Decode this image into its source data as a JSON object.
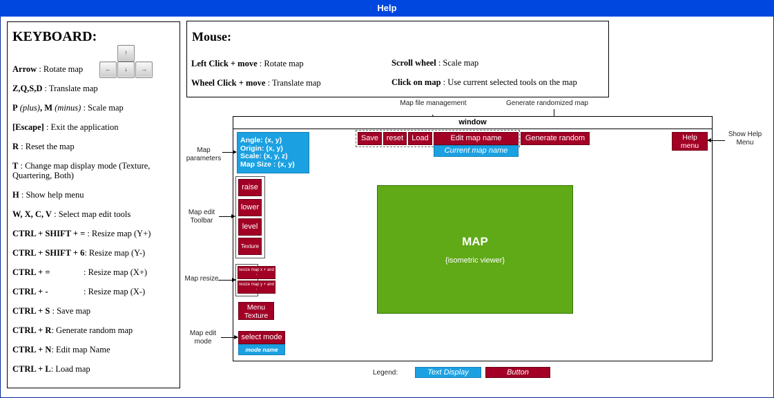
{
  "title": "Help",
  "keyboard": {
    "heading": "KEYBOARD:",
    "key_up": "↑",
    "key_left": "←",
    "key_down": "↓",
    "key_right": "→",
    "rows": [
      {
        "key": "Arrow",
        "desc": "   : Rotate map"
      },
      {
        "key": "Z,Q,S,D",
        "desc": " : Translate map"
      },
      {
        "key": "P",
        "mid1": " (plus)",
        "key2": ", M",
        "mid2": " (minus)",
        "desc": " : Scale map"
      },
      {
        "key": "[Escape]",
        "desc": " : Exit the application"
      },
      {
        "key": "R",
        "desc": " : Reset the map"
      },
      {
        "key": "T",
        "desc": " : Change map display mode (Texture,",
        "desc2": "Quartering, Both)"
      },
      {
        "key": "H",
        "desc": " : Show help menu"
      },
      {
        "key": "W, X, C, V",
        "desc": " : Select map edit tools"
      },
      {
        "key": "CTRL + SHIFT + = ",
        "desc": ":  Resize map (Y+)"
      },
      {
        "key": "CTRL + SHIFT +  6",
        "desc": ":  Resize map (Y-)"
      },
      {
        "key": "CTRL + =",
        "desc": ": Resize map (X+)"
      },
      {
        "key": "CTRL + -",
        "desc": ": Resize map (X-)"
      },
      {
        "key": "CTRL + S",
        "desc": " : Save map"
      },
      {
        "key": "CTRL + R",
        "desc": ": Generate random map"
      },
      {
        "key": "CTRL + N",
        "desc": ": Edit map Name"
      },
      {
        "key": "CTRL + L",
        "desc": ": Load map"
      }
    ]
  },
  "mouse": {
    "heading": "Mouse:",
    "left_click": {
      "key": "Left Click + move",
      "desc": " : Rotate map"
    },
    "wheel_click": {
      "key": "Wheel Click + move",
      "desc": " : Translate map"
    },
    "scroll": {
      "key": "Scroll wheel",
      "desc": " : Scale map"
    },
    "click_map": {
      "key": "Click on map",
      "desc": " : Use current selected tools on the map"
    }
  },
  "diagram": {
    "label_file_mgmt": "Map file management",
    "label_random": "Generate randomized map",
    "window_title": "window",
    "label_show_help": "Show Help Menu",
    "label_params": "Map parameters",
    "label_toolbar": "Map edit Toolbar",
    "label_resize": "Map resize",
    "label_mode": "Map edit mode",
    "params": {
      "angle": "Angle: (x, y)",
      "origin": "Origin: (x, y)",
      "scale": "Scale: (x, y, z)",
      "size": "Map Size : (x, y)"
    },
    "buttons": {
      "save": "Save",
      "reset": "reset",
      "load": "Load",
      "edit_name": "Edit map name",
      "generate": "Generate random",
      "help": "Help menu",
      "raise": "raise",
      "lower": "lower",
      "level": "level",
      "texture": "Texture",
      "resize_x": "resize map x + and -",
      "resize_y": "resize map y + and -",
      "menu_texture": "Menu Texture",
      "select_mode": "select mode"
    },
    "current_map_name": "Current map name",
    "mode_name": "mode name",
    "map_title": "MAP",
    "map_subtitle": "{isometric viewer}"
  },
  "legend": {
    "label": "Legend:",
    "text_display": "Text Display",
    "button": "Button"
  },
  "colors": {
    "titlebar": "#0047e0",
    "button": "#a20025",
    "text_display": "#1ba1e2",
    "map": "#60a917"
  }
}
